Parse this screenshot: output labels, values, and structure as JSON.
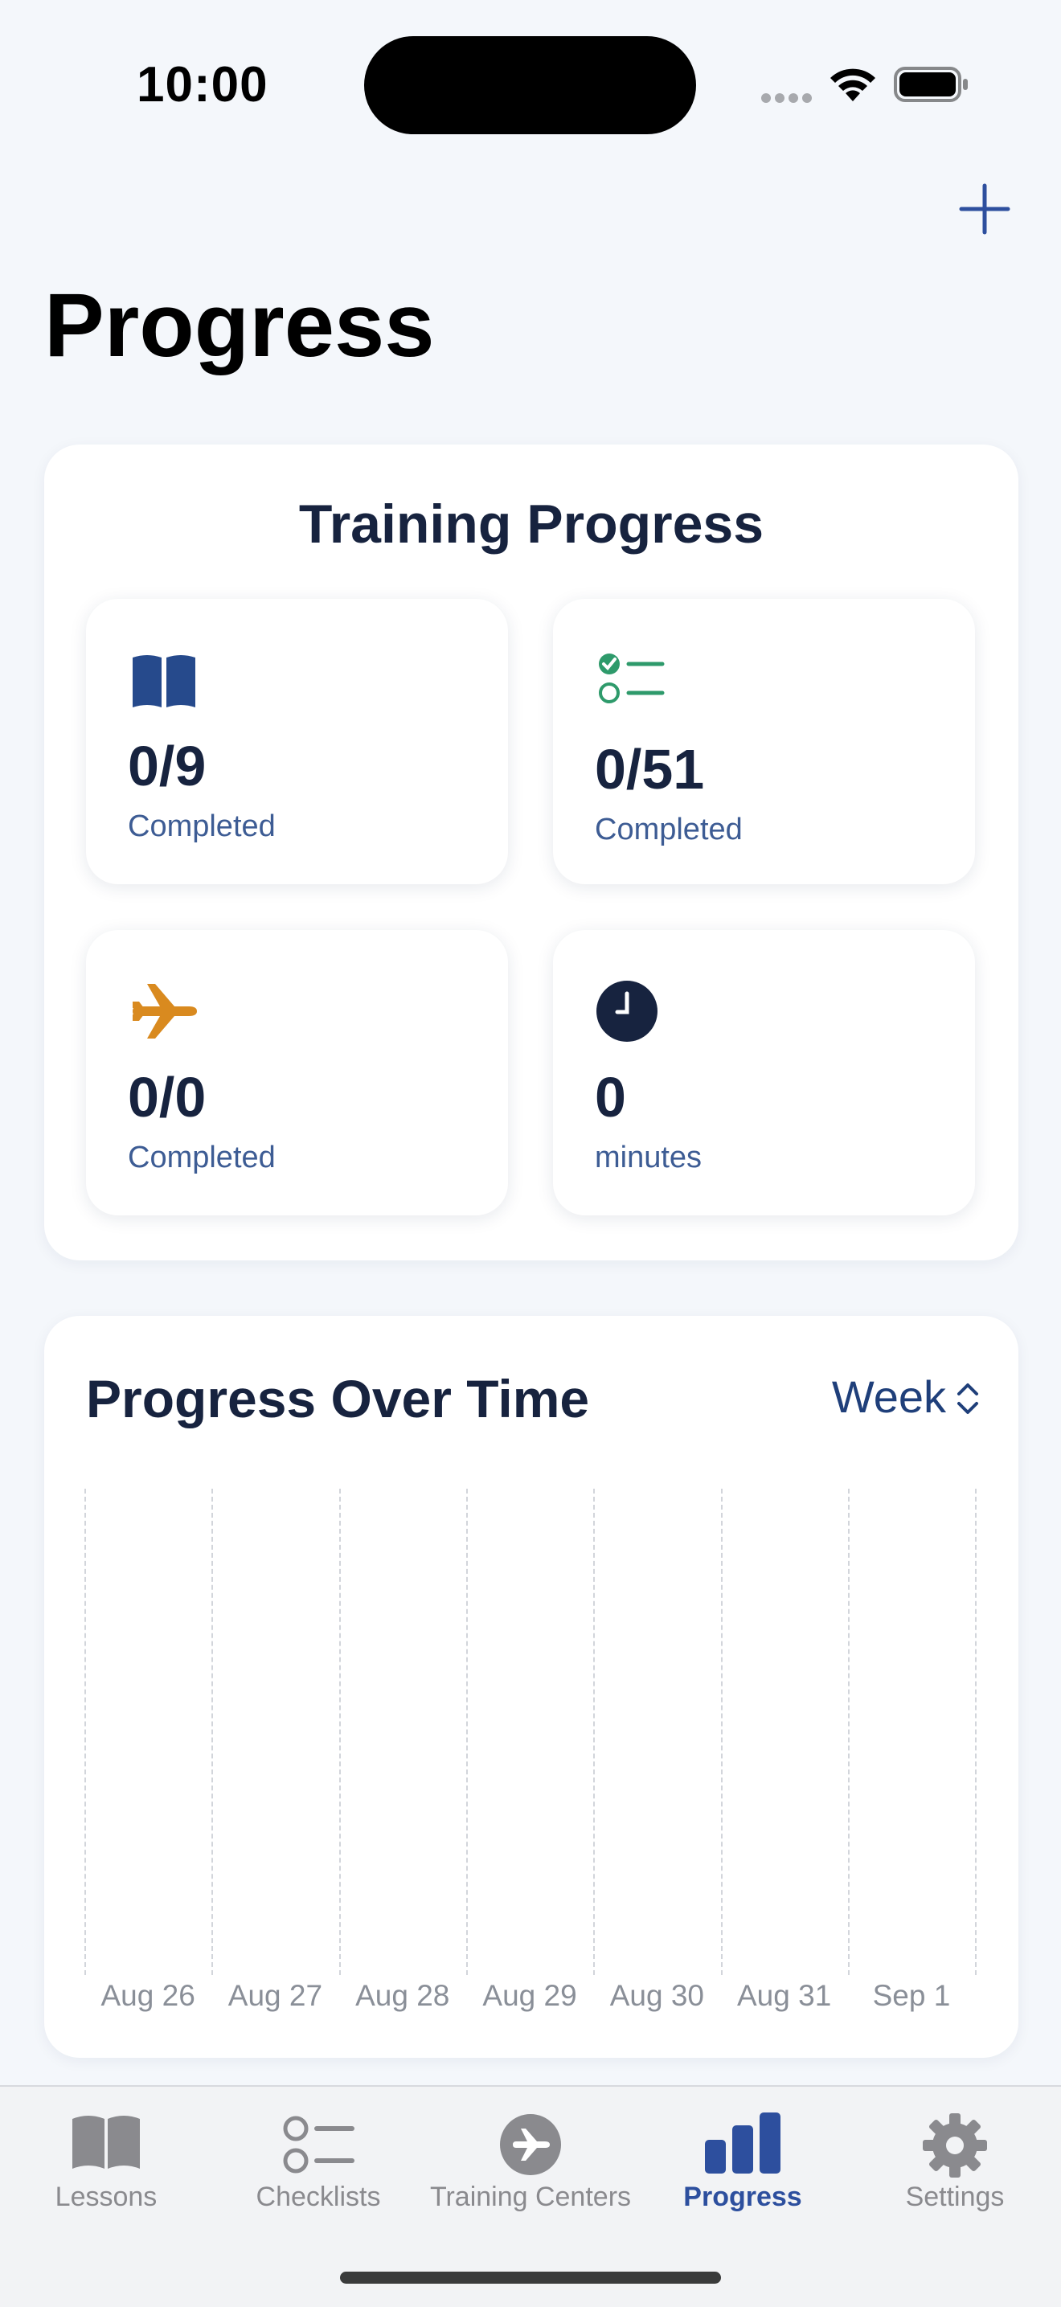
{
  "status_bar": {
    "time": "10:00"
  },
  "header": {
    "title": "Progress",
    "add_icon": "plus-icon"
  },
  "training_progress": {
    "title": "Training Progress",
    "stats": [
      {
        "icon": "book-icon",
        "value": "0/9",
        "label": "Completed",
        "color": "#264a8c"
      },
      {
        "icon": "checklist-icon",
        "value": "0/51",
        "label": "Completed",
        "color": "#2e9a6b"
      },
      {
        "icon": "airplane-icon",
        "value": "0/0",
        "label": "Completed",
        "color": "#d98a1f"
      },
      {
        "icon": "clock-icon",
        "value": "0",
        "label": "minutes",
        "color": "#17233f"
      }
    ]
  },
  "progress_over_time": {
    "title": "Progress Over Time",
    "period": "Week",
    "chart_data": {
      "type": "bar",
      "categories": [
        "Aug 26",
        "Aug 27",
        "Aug 28",
        "Aug 29",
        "Aug 30",
        "Aug 31",
        "Sep 1"
      ],
      "values": [
        0,
        0,
        0,
        0,
        0,
        0,
        0
      ],
      "title": "Progress Over Time",
      "grid": "vertical dashed"
    }
  },
  "tabs": [
    {
      "label": "Lessons",
      "icon": "book-icon",
      "active": false
    },
    {
      "label": "Checklists",
      "icon": "checklist-icon",
      "active": false
    },
    {
      "label": "Training Centers",
      "icon": "airplane-circle-icon",
      "active": false
    },
    {
      "label": "Progress",
      "icon": "bar-chart-icon",
      "active": true
    },
    {
      "label": "Settings",
      "icon": "gear-icon",
      "active": false
    }
  ],
  "colors": {
    "accent": "#2d4f9e",
    "background": "#f4f7fb",
    "tab_inactive": "#8a8a8e"
  }
}
